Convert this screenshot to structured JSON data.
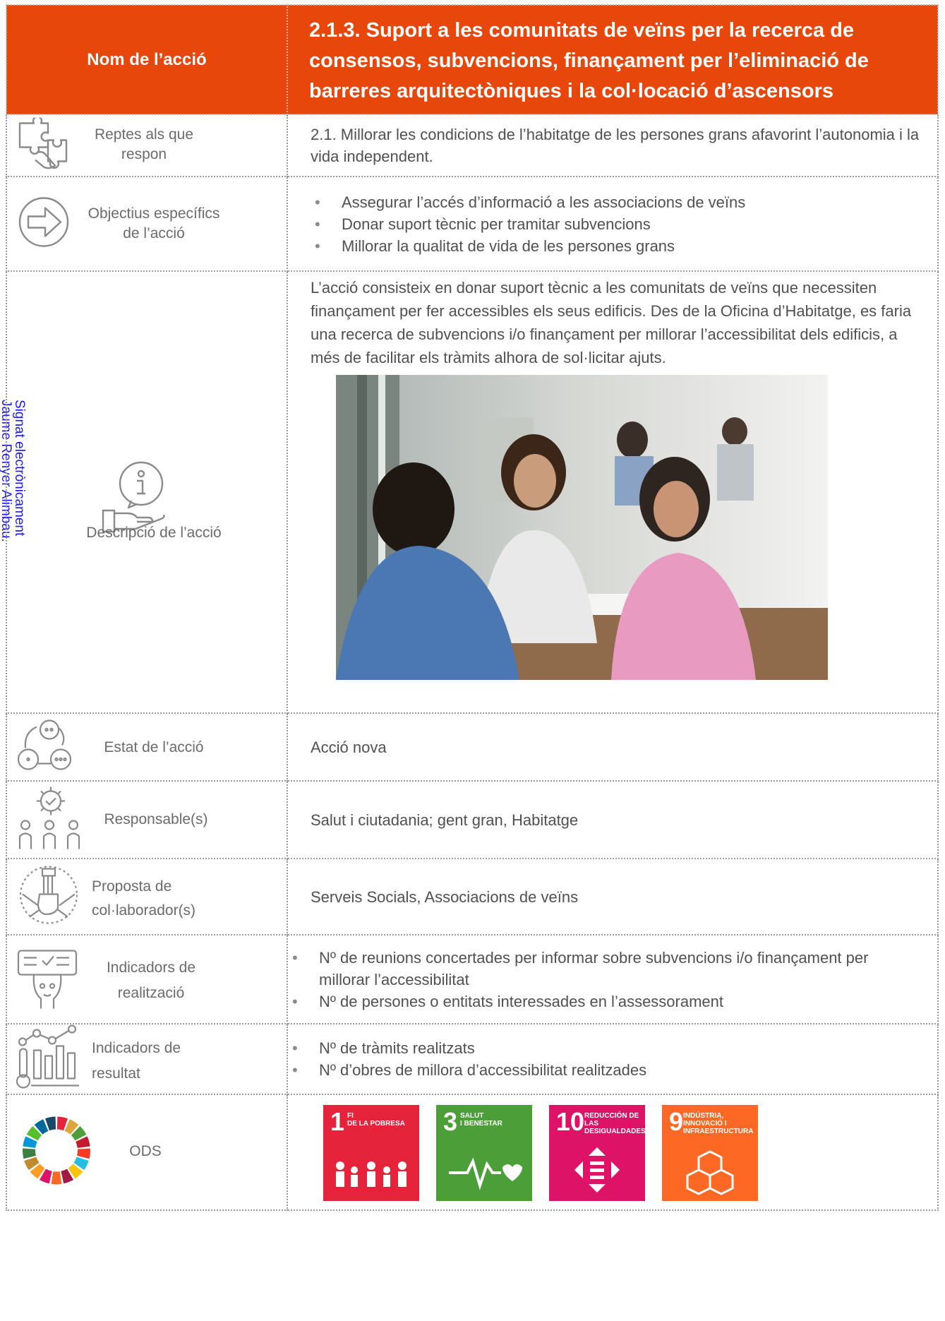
{
  "header": {
    "name_label": "Nom de l’acció",
    "title": "2.1.3. Suport a les comunitats de veïns per la recerca de consensos, subvencions, finançament per l’eliminació de barreres arquitectòniques i la col·locació d’ascensors"
  },
  "side_stamp": {
    "line1": "Signat electrònicament",
    "line2": "Jaume Renyer Alimbau."
  },
  "rows": {
    "reptes": {
      "label_1": "Reptes als que",
      "label_2": "respon",
      "value": "2.1. Millorar les condicions de l’habitatge de les persones grans afavorint l’autonomia i la vida independent."
    },
    "objectius": {
      "label_1": "Objectius específics",
      "label_2": "de l’acció",
      "items": [
        "Assegurar l’accés d’informació a les associacions de veïns",
        "Donar suport tècnic per tramitar subvencions",
        "Millorar la qualitat de vida de les persones grans"
      ]
    },
    "descripcio": {
      "label": "Descripció de l’acció",
      "value": "L’acció consisteix en donar suport tècnic a les comunitats de veïns que necessiten finançament per fer accessibles els seus edificis. Des de la Oficina d’Habitatge, es faria una recerca de subvencions i/o finançament per millorar l’accessibilitat dels edificis, a més de facilitar els tràmits alhora de sol·licitar ajuts."
    },
    "estat": {
      "label": "Estat de l’acció",
      "value": "Acció nova"
    },
    "responsables": {
      "label": "Responsable(s)",
      "value": "Salut i ciutadania; gent gran, Habitatge"
    },
    "proposta": {
      "label_1": "Proposta de",
      "label_2": "col·laborador(s)",
      "value": "Serveis Socials, Associacions de veïns"
    },
    "realitzacio": {
      "label_1": "Indicadors de",
      "label_2": "realització",
      "items": [
        "Nº de reunions concertades per informar sobre subvencions i/o finançament per millorar l’accessibilitat",
        "Nº de persones o entitats interessades en l’assessorament"
      ]
    },
    "resultat": {
      "label_1": "Indicadors de",
      "label_2": "resultat",
      "items": [
        "Nº de tràmits realitzats",
        "Nº d’obres de millora d’accessibilitat realitzades"
      ]
    },
    "ods": {
      "label": "ODS",
      "tiles": [
        {
          "num": "1",
          "cap_1": "FI",
          "cap_2": "DE LA POBRESA",
          "color": "#e5243b"
        },
        {
          "num": "3",
          "cap_1": "SALUT",
          "cap_2": "I BENESTAR",
          "color": "#4c9f38"
        },
        {
          "num": "10",
          "cap_1": "REDUCCIÓN DE LAS",
          "cap_2": "DESIGUALDADES",
          "color": "#dd1367"
        },
        {
          "num": "9",
          "cap_1": "INDÚSTRIA,",
          "cap_2": "INNOVACIÓ I",
          "cap_3": "INFRAESTRUCTURA",
          "color": "#fd6925"
        }
      ]
    }
  }
}
